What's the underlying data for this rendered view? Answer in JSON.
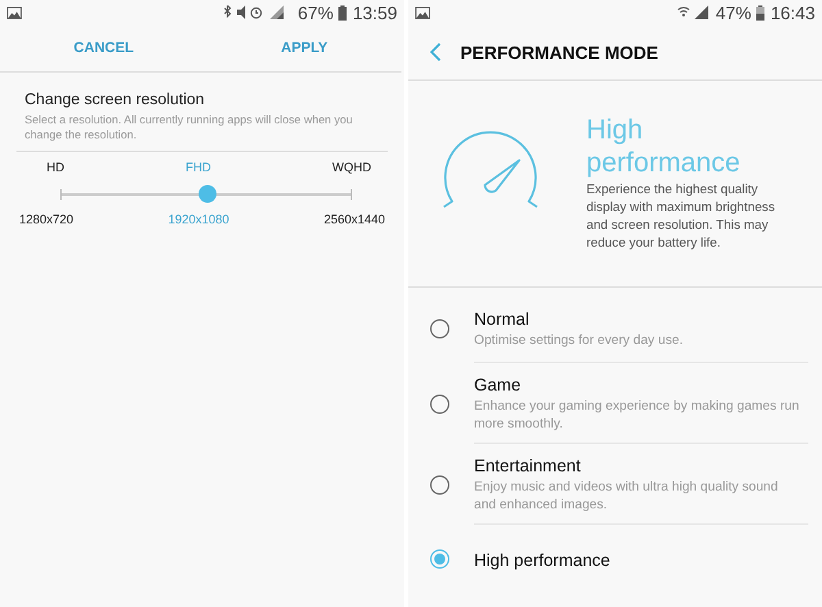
{
  "left_screen": {
    "status_bar": {
      "battery": "67%",
      "time": "13:59"
    },
    "actions": [
      "CANCEL",
      "APPLY"
    ],
    "resolution": {
      "title": "Change screen resolution",
      "description": "Select a resolution. All currently running apps will close when you change the resolution.",
      "slider": {
        "level": 0.5
      },
      "options": [
        {
          "name": "HD",
          "size": "1280x720",
          "selected": false
        },
        {
          "name": "FHD",
          "size": "1920x1080",
          "selected": true
        },
        {
          "name": "WQHD",
          "size": "2560x1440",
          "selected": false
        }
      ]
    }
  },
  "right_screen": {
    "status_bar": {
      "battery": "47%",
      "time": "16:43"
    },
    "title": "PERFORMANCE MODE",
    "hero": {
      "title": "High performance",
      "description": "Experience the highest quality display with maximum brightness and screen resolution. This may reduce your battery life."
    },
    "modes": [
      {
        "name": "Normal",
        "description": "Optimise settings for every day use.",
        "selected": false
      },
      {
        "name": "Game",
        "description": "Enhance your gaming experience by making games run more smoothly.",
        "selected": false
      },
      {
        "name": "Entertainment",
        "description": "Enjoy music and videos with ultra high quality sound and enhanced images.",
        "selected": false
      },
      {
        "name": "High performance",
        "selected": true
      }
    ]
  }
}
